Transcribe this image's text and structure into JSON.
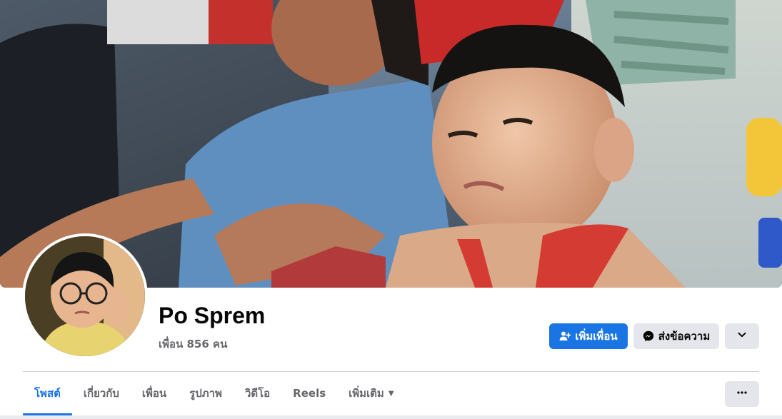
{
  "profile": {
    "name": "Po Sprem",
    "friends": "เพื่อน 856 คน"
  },
  "actions": {
    "add_friend": "เพิ่มเพื่อน",
    "message": "ส่งข้อความ"
  },
  "tabs": [
    {
      "label": "โพสต์",
      "active": true
    },
    {
      "label": "เกี่ยวกับ"
    },
    {
      "label": "เพื่อน"
    },
    {
      "label": "รูปภาพ"
    },
    {
      "label": "วิดีโอ"
    },
    {
      "label": "Reels"
    },
    {
      "label": "เพิ่มเติม"
    }
  ],
  "colors": {
    "accent": "#1b74e4",
    "secondary_button": "#e4e6eb",
    "muted_text": "#65676b"
  },
  "icons": {
    "add_friend": "add-person-icon",
    "message": "messenger-icon",
    "more_actions": "chevron-down-icon",
    "more_tabs": "caret-down-icon",
    "overflow": "ellipsis-icon"
  }
}
